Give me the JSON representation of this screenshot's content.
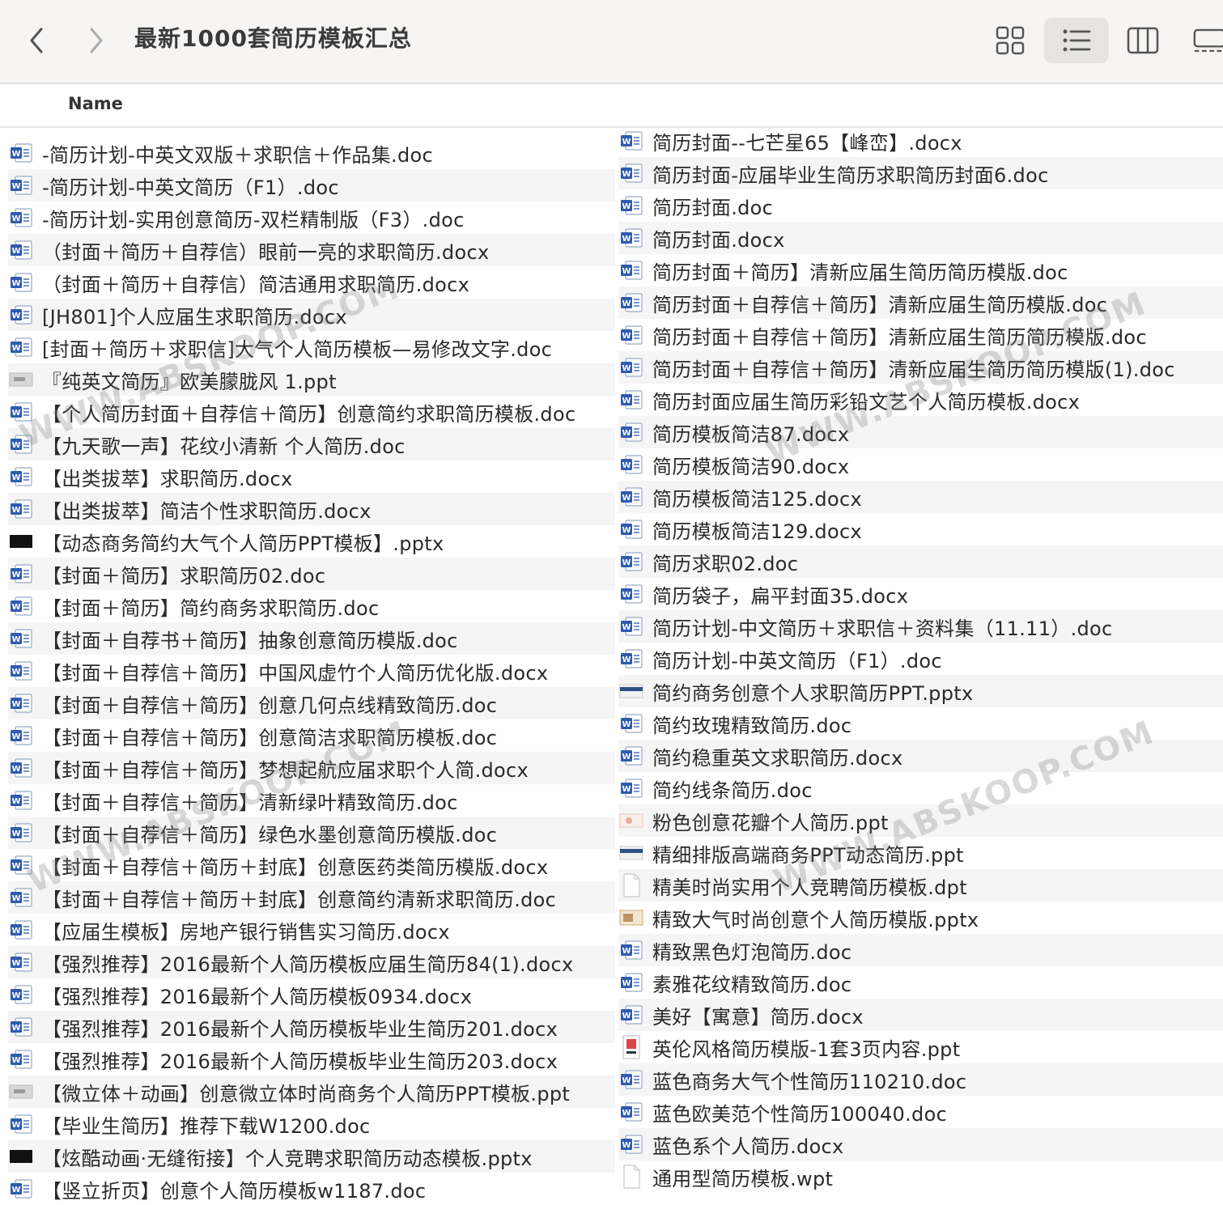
{
  "window": {
    "title": "最新1000套简历模板汇总"
  },
  "toolbar": {
    "back_icon": "chevron-left-icon",
    "forward_icon": "chevron-right-icon",
    "views": [
      "icon-view",
      "list-view",
      "column-view",
      "gallery-view"
    ],
    "active_view": "list-view"
  },
  "list_header": {
    "name": "Name"
  },
  "left_files": [
    {
      "name": "-简历计划-中英文双版＋求职信＋作品集.doc",
      "icon": "word"
    },
    {
      "name": "-简历计划-中英文简历（F1）.doc",
      "icon": "word"
    },
    {
      "name": "-简历计划-实用创意简历-双栏精制版（F3）.doc",
      "icon": "word"
    },
    {
      "name": "（封面＋简历＋自荐信）眼前一亮的求职简历.docx",
      "icon": "word"
    },
    {
      "name": "（封面＋简历＋自荐信）简洁通用求职简历.docx",
      "icon": "word"
    },
    {
      "name": "[JH801]个人应届生求职简历.docx",
      "icon": "word"
    },
    {
      "name": "[封面＋简历＋求职信]大气个人简历模板—易修改文字.doc",
      "icon": "word"
    },
    {
      "name": "『纯英文简历』欧美朦胧风 1.ppt",
      "icon": "ppt-thumb"
    },
    {
      "name": "【个人简历封面＋自荐信＋简历】创意简约求职简历模板.doc",
      "icon": "word"
    },
    {
      "name": "【九天歌一声】花纹小清新 个人简历.doc",
      "icon": "word"
    },
    {
      "name": "【出类拔萃】求职简历.docx",
      "icon": "word"
    },
    {
      "name": "【出类拔萃】简洁个性求职简历.docx",
      "icon": "word"
    },
    {
      "name": "【动态商务简约大气个人简历PPT模板】.pptx",
      "icon": "black-thumb"
    },
    {
      "name": "【封面＋简历】求职简历02.doc",
      "icon": "word"
    },
    {
      "name": "【封面＋简历】简约商务求职简历.doc",
      "icon": "word"
    },
    {
      "name": "【封面＋自荐书＋简历】抽象创意简历模版.doc",
      "icon": "word"
    },
    {
      "name": "【封面＋自荐信＋简历】中国风虚竹个人简历优化版.docx",
      "icon": "word"
    },
    {
      "name": "【封面＋自荐信＋简历】创意几何点线精致简历.doc",
      "icon": "word"
    },
    {
      "name": "【封面＋自荐信＋简历】创意简洁求职简历模板.doc",
      "icon": "word"
    },
    {
      "name": "【封面＋自荐信＋简历】梦想起航应届求职个人简.docx",
      "icon": "word"
    },
    {
      "name": "【封面＋自荐信＋简历】清新绿叶精致简历.doc",
      "icon": "word"
    },
    {
      "name": "【封面＋自荐信＋简历】绿色水墨创意简历模版.doc",
      "icon": "word"
    },
    {
      "name": "【封面＋自荐信＋简历＋封底】创意医药类简历模版.docx",
      "icon": "word"
    },
    {
      "name": "【封面＋自荐信＋简历＋封底】创意简约清新求职简历.doc",
      "icon": "word"
    },
    {
      "name": "【应届生模板】房地产银行销售实习简历.docx",
      "icon": "word"
    },
    {
      "name": "【强烈推荐】2016最新个人简历模板应届生简历84(1).docx",
      "icon": "word"
    },
    {
      "name": "【强烈推荐】2016最新个人简历模板0934.docx",
      "icon": "word"
    },
    {
      "name": "【强烈推荐】2016最新个人简历模板毕业生简历201.docx",
      "icon": "word"
    },
    {
      "name": "【强烈推荐】2016最新个人简历模板毕业生简历203.docx",
      "icon": "word"
    },
    {
      "name": "【微立体＋动画】创意微立体时尚商务个人简历PPT模板.ppt",
      "icon": "ppt-thumb"
    },
    {
      "name": "【毕业生简历】推荐下载W1200.doc",
      "icon": "word"
    },
    {
      "name": "【炫酷动画·无缝衔接】个人竞聘求职简历动态模板.pptx",
      "icon": "black-thumb"
    },
    {
      "name": "【竖立折页】创意个人简历模板w1187.doc",
      "icon": "word"
    }
  ],
  "right_files": [
    {
      "name": "简历封面--七芒星65【峰峦】.docx",
      "icon": "word"
    },
    {
      "name": "简历封面-应届毕业生简历求职简历封面6.doc",
      "icon": "word"
    },
    {
      "name": "简历封面.doc",
      "icon": "word"
    },
    {
      "name": "简历封面.docx",
      "icon": "word"
    },
    {
      "name": "简历封面＋简历】清新应届生简历简历模版.doc",
      "icon": "word"
    },
    {
      "name": "简历封面＋自荐信＋简历】清新应届生简历模版.doc",
      "icon": "word"
    },
    {
      "name": "简历封面＋自荐信＋简历】清新应届生简历简历模版.doc",
      "icon": "word"
    },
    {
      "name": "简历封面＋自荐信＋简历】清新应届生简历简历模版(1).doc",
      "icon": "word"
    },
    {
      "name": "简历封面应届生简历彩铅文艺个人简历模板.docx",
      "icon": "word"
    },
    {
      "name": "简历模板简洁87.docx",
      "icon": "word"
    },
    {
      "name": "简历模板简洁90.docx",
      "icon": "word"
    },
    {
      "name": "简历模板简洁125.docx",
      "icon": "word"
    },
    {
      "name": "简历模板简洁129.docx",
      "icon": "word"
    },
    {
      "name": "简历求职02.doc",
      "icon": "word"
    },
    {
      "name": "简历袋子，扁平封面35.docx",
      "icon": "word"
    },
    {
      "name": "简历计划-中文简历＋求职信＋资料集（11.11）.doc",
      "icon": "word"
    },
    {
      "name": "简历计划-中英文简历（F1）.doc",
      "icon": "word"
    },
    {
      "name": "简约商务创意个人求职简历PPT.pptx",
      "icon": "blue-thumb"
    },
    {
      "name": "简约玫瑰精致简历.doc",
      "icon": "word"
    },
    {
      "name": "简约稳重英文求职简历.docx",
      "icon": "word"
    },
    {
      "name": "简约线条简历.doc",
      "icon": "word"
    },
    {
      "name": "粉色创意花瓣个人简历.ppt",
      "icon": "pink-thumb"
    },
    {
      "name": "精细排版高端商务PPT动态简历.ppt",
      "icon": "blue-thumb"
    },
    {
      "name": "精美时尚实用个人竞聘简历模板.dpt",
      "icon": "blank"
    },
    {
      "name": "精致大气时尚创意个人简历模版.pptx",
      "icon": "cert-thumb"
    },
    {
      "name": "精致黑色灯泡简历.doc",
      "icon": "word"
    },
    {
      "name": "素雅花纹精致简历.doc",
      "icon": "word"
    },
    {
      "name": "美好【寓意】简历.docx",
      "icon": "word"
    },
    {
      "name": "英伦风格简历模版-1套3页内容.ppt",
      "icon": "red-thumb"
    },
    {
      "name": "蓝色商务大气个性简历110210.doc",
      "icon": "word"
    },
    {
      "name": "蓝色欧美范个性简历100040.doc",
      "icon": "word"
    },
    {
      "name": "蓝色系个人简历.docx",
      "icon": "word"
    },
    {
      "name": "通用型简历模板.wpt",
      "icon": "blank"
    }
  ],
  "watermark": {
    "text": "WWW.ABSKOOP.COM"
  }
}
